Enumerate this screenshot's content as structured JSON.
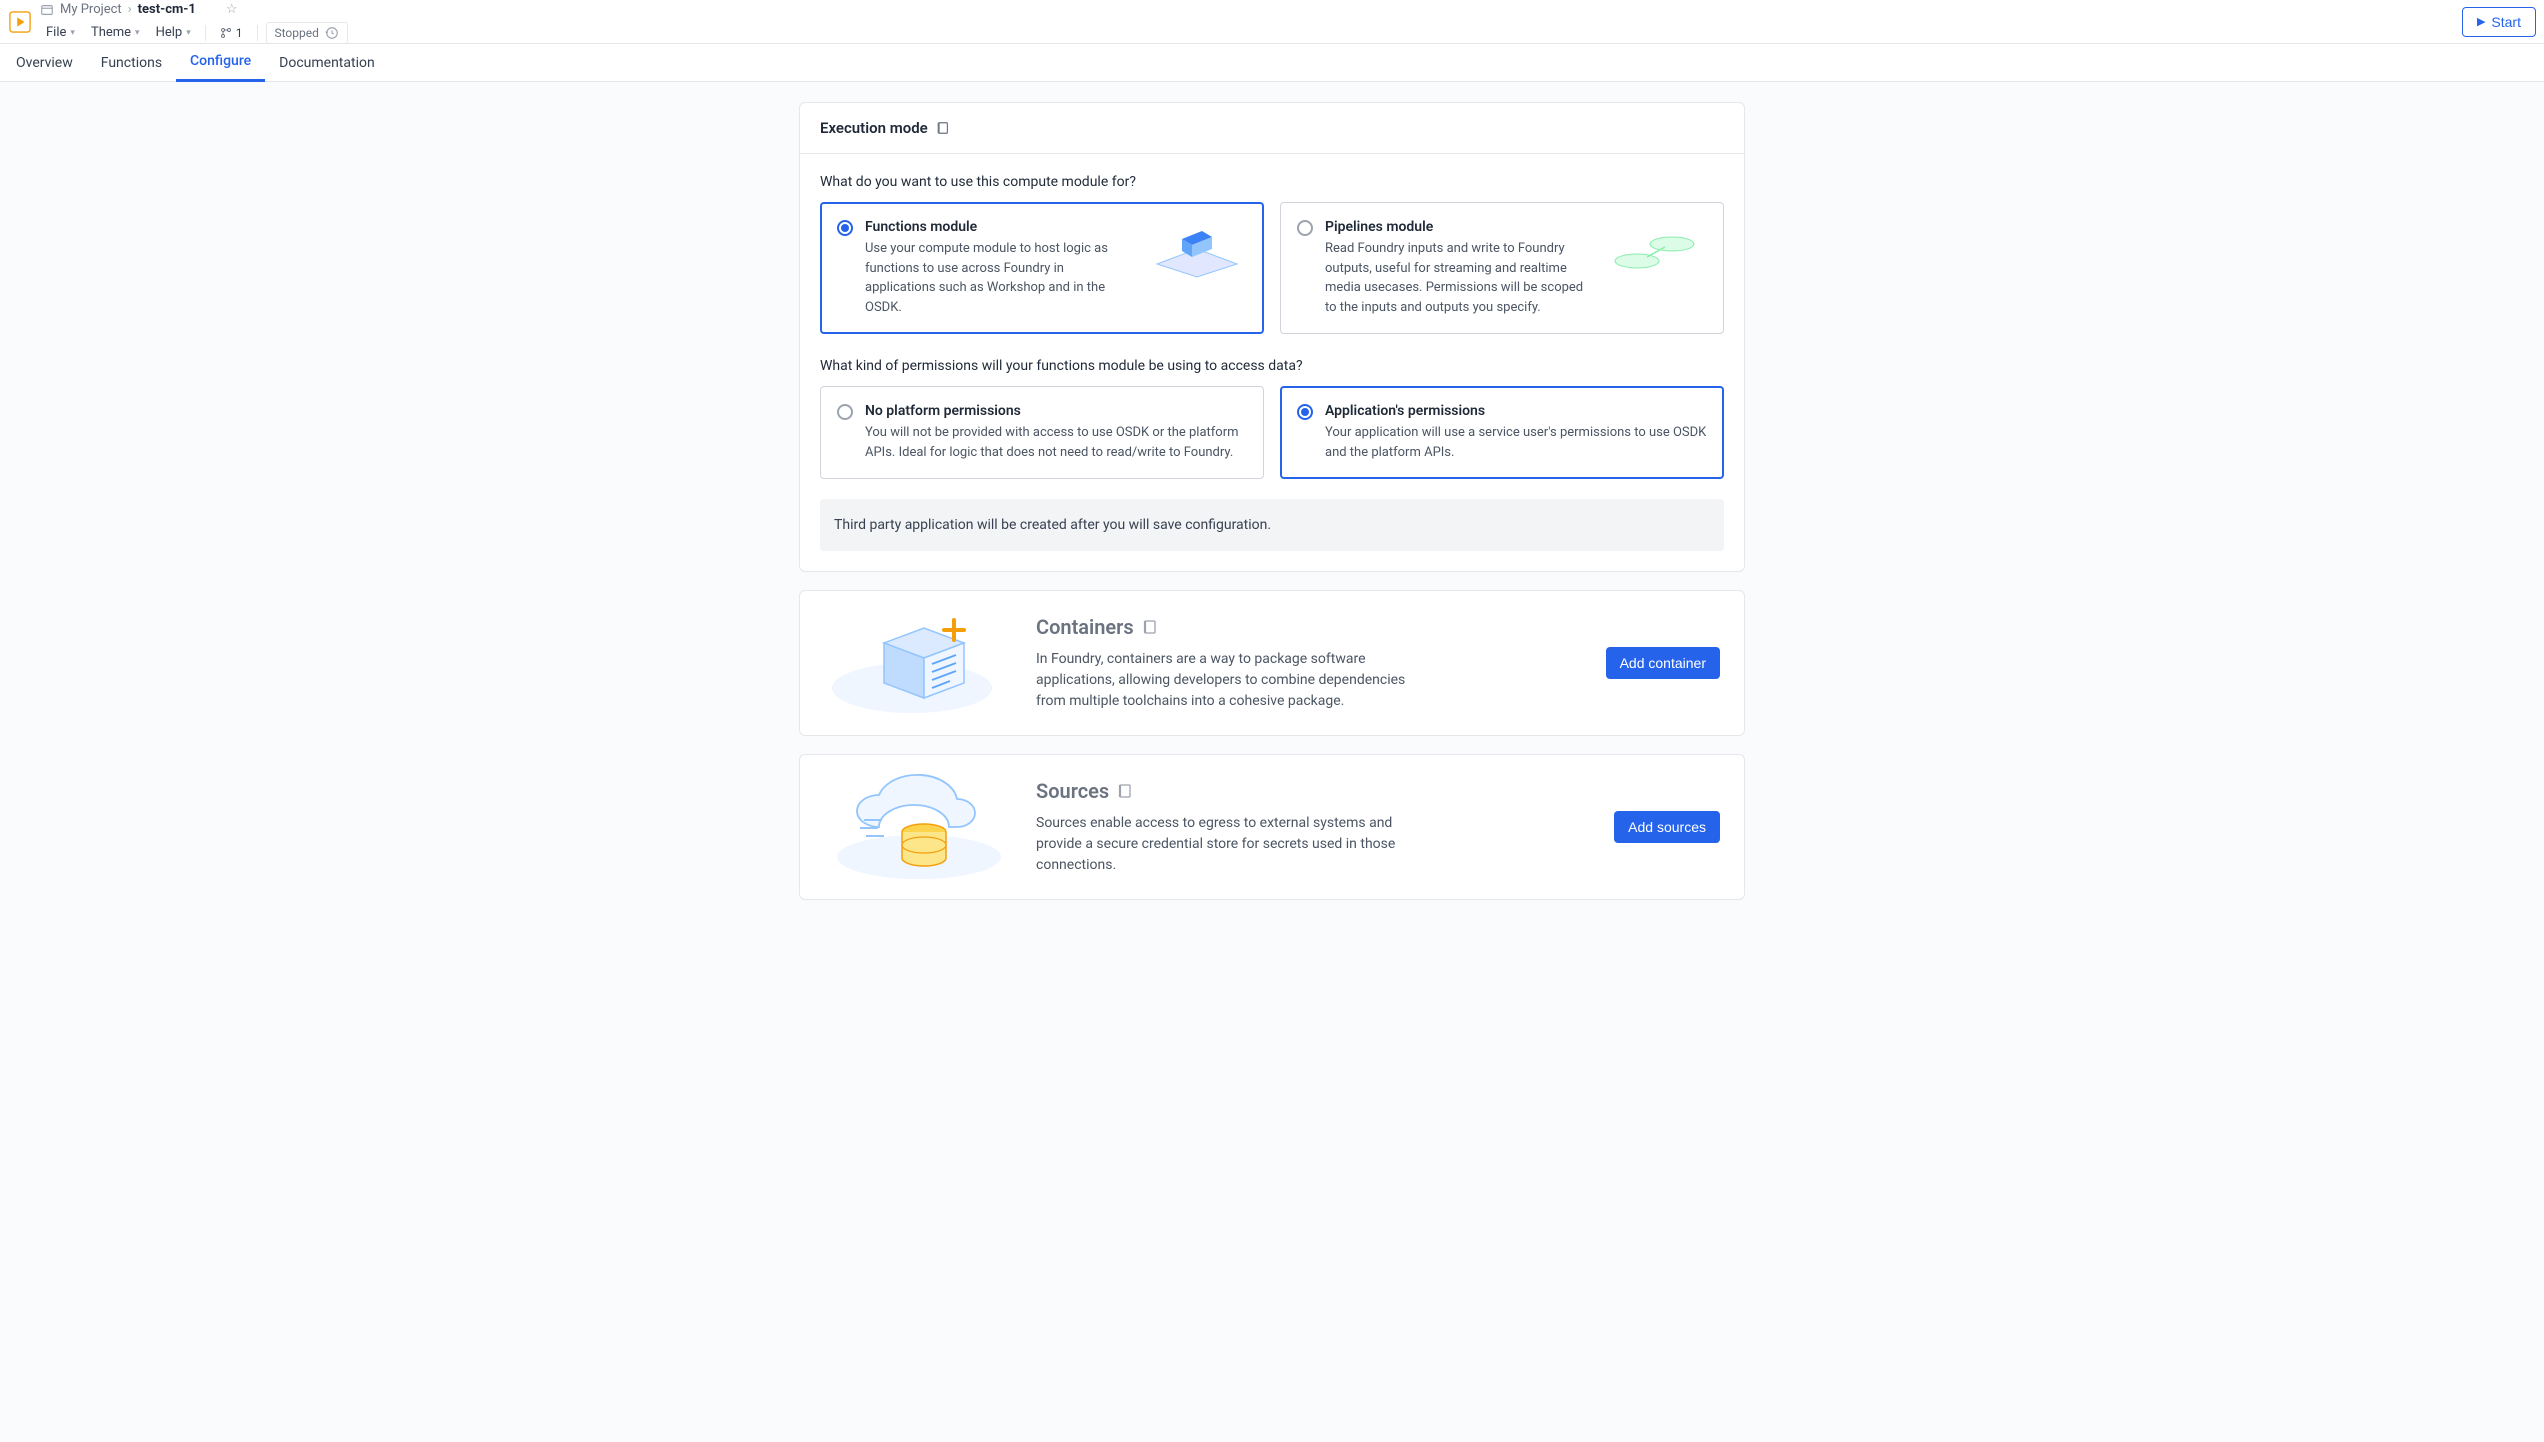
{
  "header": {
    "breadcrumb_project": "My Project",
    "breadcrumb_title": "test-cm-1",
    "menu": {
      "file": "File",
      "theme": "Theme",
      "help": "Help"
    },
    "branch_count": "1",
    "status": "Stopped",
    "start_button": "Start"
  },
  "tabs": {
    "overview": "Overview",
    "functions": "Functions",
    "configure": "Configure",
    "documentation": "Documentation",
    "active": "configure"
  },
  "execution_mode": {
    "header": "Execution mode",
    "question1": "What do you want to use this compute module for?",
    "option_functions": {
      "title": "Functions module",
      "desc": "Use your compute module to host logic as functions to use across Foundry in applications such as Workshop and in the OSDK."
    },
    "option_pipelines": {
      "title": "Pipelines module",
      "desc": "Read Foundry inputs and write to Foundry outputs, useful for streaming and realtime media usecases. Permissions will be scoped to the inputs and outputs you specify."
    },
    "question2": "What kind of permissions will your functions module be using to access data?",
    "option_noperm": {
      "title": "No platform permissions",
      "desc": "You will not be provided with access to use OSDK or the platform APIs. Ideal for logic that does not need to read/write to Foundry."
    },
    "option_appperm": {
      "title": "Application's permissions",
      "desc": "Your application will use a service user's permissions to use OSDK and the platform APIs."
    },
    "banner": "Third party application will be created after you will save configuration."
  },
  "containers": {
    "title": "Containers",
    "desc": "In Foundry, containers are a way to package software applications, allowing developers to combine dependencies from multiple toolchains into a cohesive package.",
    "button": "Add container"
  },
  "sources": {
    "title": "Sources",
    "desc": "Sources enable access to egress to external systems and provide a secure credential store for secrets used in those connections.",
    "button": "Add sources"
  }
}
